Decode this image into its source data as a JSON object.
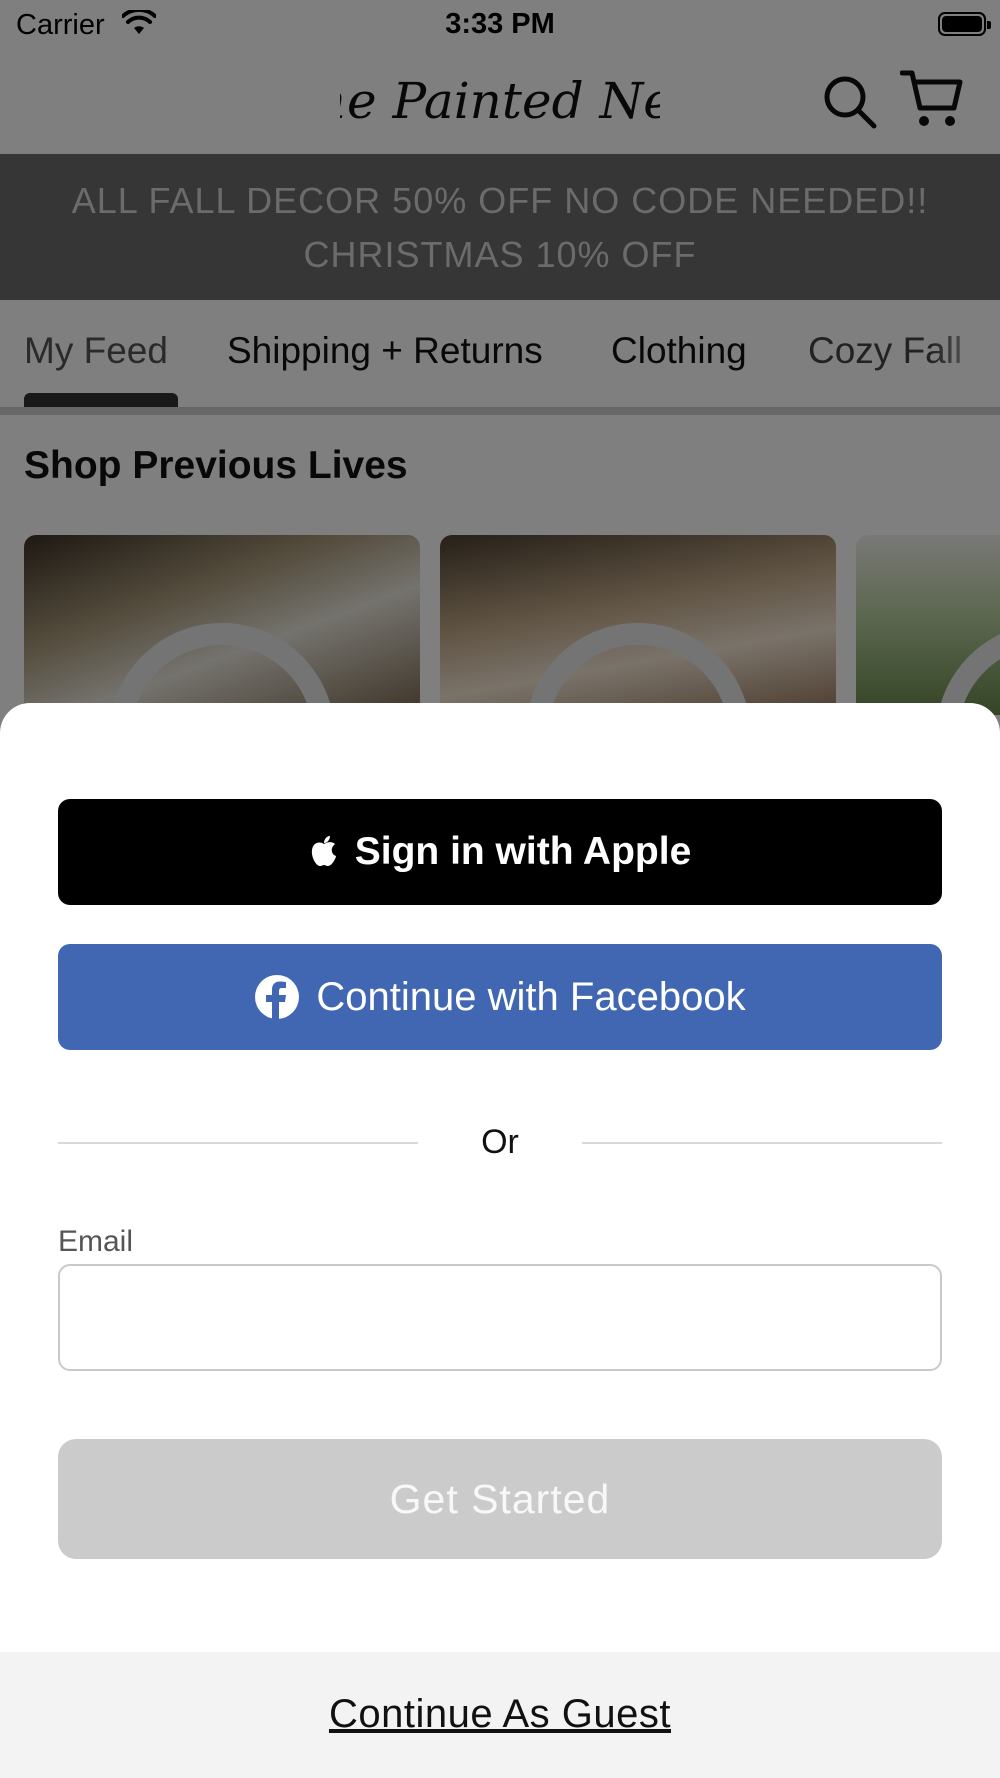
{
  "status_bar": {
    "carrier": "Carrier",
    "time": "3:33 PM"
  },
  "header": {
    "logo_text": "The Painted Nest",
    "icons": [
      "search-icon",
      "cart-icon"
    ]
  },
  "promo": {
    "line1": "ALL FALL DECOR 50% OFF NO CODE NEEDED!!",
    "line2": "CHRISTMAS 10% OFF"
  },
  "tabs": [
    {
      "label": "My Feed",
      "active": true
    },
    {
      "label": "Shipping + Returns",
      "active": false
    },
    {
      "label": "Clothing",
      "active": false
    },
    {
      "label": "Cozy Fall",
      "active": false
    }
  ],
  "section": {
    "title": "Shop Previous Lives"
  },
  "sheet": {
    "apple_button": "Sign in with Apple",
    "facebook_button": "Continue with Facebook",
    "or_text": "Or",
    "email_label": "Email",
    "email_value": "",
    "email_placeholder": "",
    "get_started_button": "Get Started",
    "guest_link": "Continue As Guest"
  },
  "colors": {
    "facebook_blue": "#4267b2",
    "apple_black": "#000000",
    "disabled_button": "#cbcbcb",
    "promo_banner": "#6c6c6c"
  }
}
